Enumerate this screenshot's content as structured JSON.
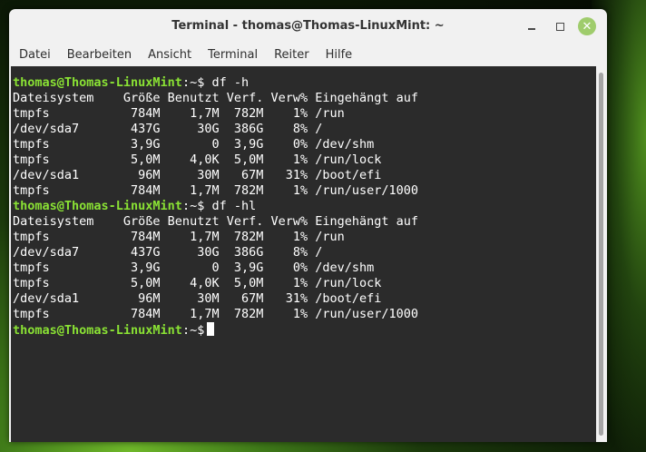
{
  "window": {
    "title": "Terminal - thomas@Thomas-LinuxMint: ~"
  },
  "menubar": {
    "items": [
      "Datei",
      "Bearbeiten",
      "Ansicht",
      "Terminal",
      "Reiter",
      "Hilfe"
    ]
  },
  "terminal": {
    "prompt_user": "thomas@Thomas-LinuxMint",
    "prompt_suffix": ":~$",
    "lines": [
      {
        "prompt": true,
        "command": " df -h"
      },
      {
        "text": "Dateisystem    Größe Benutzt Verf. Verw% Eingehängt auf"
      },
      {
        "text": "tmpfs           784M    1,7M  782M    1% /run"
      },
      {
        "text": "/dev/sda7       437G     30G  386G    8% /"
      },
      {
        "text": "tmpfs           3,9G       0  3,9G    0% /dev/shm"
      },
      {
        "text": "tmpfs           5,0M    4,0K  5,0M    1% /run/lock"
      },
      {
        "text": "/dev/sda1        96M     30M   67M   31% /boot/efi"
      },
      {
        "text": "tmpfs           784M    1,7M  782M    1% /run/user/1000"
      },
      {
        "prompt": true,
        "command": " df -hl"
      },
      {
        "text": "Dateisystem    Größe Benutzt Verf. Verw% Eingehängt auf"
      },
      {
        "text": "tmpfs           784M    1,7M  782M    1% /run"
      },
      {
        "text": "/dev/sda7       437G     30G  386G    8% /"
      },
      {
        "text": "tmpfs           3,9G       0  3,9G    0% /dev/shm"
      },
      {
        "text": "tmpfs           5,0M    4,0K  5,0M    1% /run/lock"
      },
      {
        "text": "/dev/sda1        96M     30M   67M   31% /boot/efi"
      },
      {
        "text": "tmpfs           784M    1,7M  782M    1% /run/user/1000"
      },
      {
        "prompt": true,
        "command": "",
        "cursor": true
      }
    ]
  },
  "icons": {
    "minimize": "minimize-icon",
    "maximize": "maximize-icon",
    "close": "close-icon"
  }
}
